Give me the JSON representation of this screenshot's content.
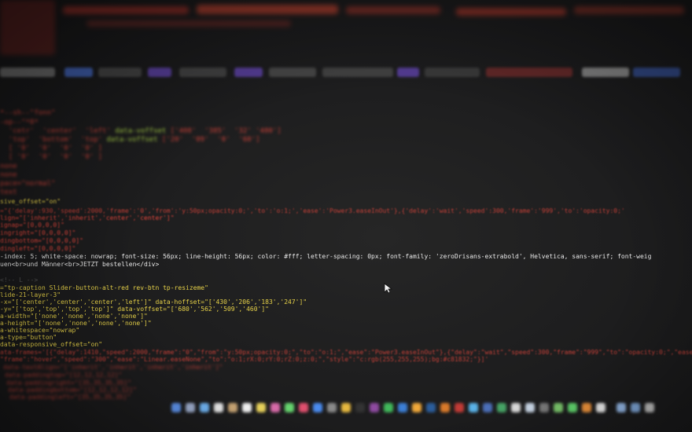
{
  "editor": {
    "line_a": "-index: 5; white-space: nowrap; font-size: 56px; line-height: 56px; color: #fff; letter-spacing: 0px; font-family: 'zeroDrisans-extrabold', Helvetica, sans-serif; font-weig",
    "line_b": "uen<br>und Männer<br>JETZT bestellen</div>",
    "line_c": "=\"tp-caption Slider-button-alt-red rev-btn tp-resizeme\"",
    "line_d": "lide-21-layer-3\"",
    "line_e": "-x=\"['center','center','center','left']\" data-hoffset=\"['430','206','183','247']\"",
    "line_f": "-y=\"['top','top','top','top']\" data-voffset=\"['680','562','509','460']\"",
    "line_g": "a-width=\"['none','none','none','none']\"",
    "line_h": "a-height=\"['none','none','none','none']\"",
    "line_i": "a-whitespace=\"nowrap\"",
    "line_j": "a-type=\"button\"",
    "line_k": "data-responsive_offset=\"on\"",
    "line_l": "ata-frames='[{\"delay\":1410,\"speed\":2000,\"frame\":\"0\",\"from\":\"y:50px;opacity:0;\",\"to\":\"o:1;\",\"ease\":\"Power3.easeInOut\"},{\"delay\":\"wait\",\"speed\":300,\"frame\":\"999\",\"to\":\"opacity:0;\",\"ease\":",
    "line_m": "\"frame\":\"hover\",\"speed\":\"300\",\"ease\":\"Linear.easeNone\",\"to\":\"o:1;rX:0;rY:0;rZ:0;z:0;\",\"style\":\"c:rgb(255,255,255);bg:#c81832;\"}]'",
    "line_n": "data-textAlign=\"['inherit','inherit','inherit','inherit']\"",
    "line_o": "data-paddingtop=\"[12,12,12,12]\"",
    "line_p": "data-paddingright=\"[35,35,35,35]\"",
    "line_q": "data-paddingbottom=\"[12,12,12,12]\"",
    "line_r": "data-paddingleft=\"[35,35,35,35]\"",
    "line_u1": "sive_offset=\"on\"",
    "line_u2": "ignap=\"[0,0,0,0]\"",
    "line_u3": "ingright=\"[0,0,0,0]\"",
    "line_u4": "dingbottom=\"[0,0,0,0]\"",
    "line_u5": "dingleft=\"[0,0,0,0]\"",
    "line_u6": "lign=\"['inherit','inherit','center','center']\"",
    "line_u7": "=\"{'delay':930,'speed':2000,'frame':'0','from':'y:50px;opacity:0;','to':'o:1;','ease':'Power3.easeInOut'},{'delay':'wait','speed':300,'frame':'999','to':'opacity:0;'",
    "line_t1": "data-voffset",
    "line_t2": "data-voffset"
  },
  "colors": {
    "red": "#e2463c",
    "yellow": "#e6d148",
    "green": "#b6e34a",
    "white": "#e7e7e7",
    "background": "#1c1c1d"
  },
  "icons": {
    "cursor": "mouse-pointer-icon",
    "dock": "dock-app-icons"
  }
}
